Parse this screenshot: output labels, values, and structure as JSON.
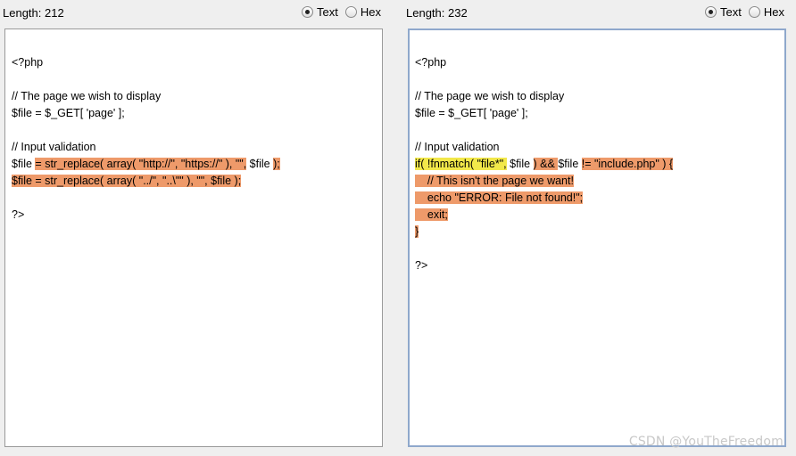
{
  "left": {
    "length_label": "Length: 212",
    "mode_options": {
      "text": "Text",
      "hex": "Hex"
    },
    "selected_mode": "Text",
    "code": {
      "l1": "<?php",
      "l2": "// The page we wish to display",
      "l3": "$file = $_GET[ 'page' ];",
      "l4": "// Input validation",
      "l5a": "$file ",
      "l5b": "= ",
      "l5c": "str_replace( array( \"http://\", \"https://\" ), \"\",",
      "l5d": " $file ",
      "l5e": ");",
      "l6": "$file = str_replace( array( \"../\", \"..\\\"\" ), \"\", $file );",
      "l7": "?>"
    }
  },
  "right": {
    "length_label": "Length: 232",
    "mode_options": {
      "text": "Text",
      "hex": "Hex"
    },
    "selected_mode": "Text",
    "code": {
      "l1": "<?php",
      "l2": "// The page we wish to display",
      "l3": "$file = $_GET[ 'page' ];",
      "l4": "// Input validation",
      "l5a": "if( !fnmatch( \"file*\",",
      "l5b": " $file ",
      "l5c": ") && ",
      "l5d": "$file ",
      "l5e": "!= \"include.php\" ) {",
      "l6": "    // This isn't the page we want!",
      "l7": "    echo \"ERROR: File not found!\";",
      "l8": "    exit;",
      "l9": "}",
      "l10": "?>"
    }
  },
  "watermark": "CSDN @YouTheFreedom",
  "colors": {
    "diff_orange": "#ee9a6a",
    "diff_yellow": "#f2e84a",
    "focus_border": "#8fa8cc"
  }
}
